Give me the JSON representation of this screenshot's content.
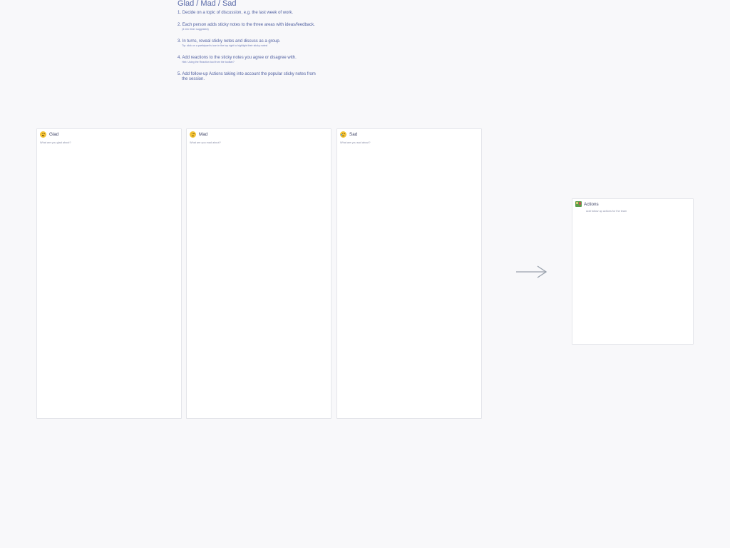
{
  "title": "Glad / Mad / Sad",
  "instructions": {
    "step1": "1. Decide on a topic of discussion, e.g. the last week of work.",
    "step2": "2. Each person adds sticky notes to the three areas with ideas/feedback.",
    "step2_sub": "(4 min timer suggested)",
    "step3": "3. In turns, reveal sticky notes and discuss as a group.",
    "step3_sub": "Tip: click on a participant's icon in the top right to highlight their sticky notes!",
    "step4": "4. Add reactions to the sticky notes you agree or disagree with.",
    "step4_sub": "Hint: Using the Reaction tool from the toolbar?",
    "step5_line1": "5. Add follow-up Actions taking into account the popular sticky notes from",
    "step5_line2": "the session."
  },
  "frames": {
    "glad": {
      "title": "Glad",
      "subtitle": "What are you glad about?"
    },
    "mad": {
      "title": "Mad",
      "subtitle": "What are you mad about?"
    },
    "sad": {
      "title": "Sad",
      "subtitle": "What are you sad about?"
    },
    "actions": {
      "title": "Actions",
      "subtitle": "Add follow up actions for the team"
    }
  },
  "icons": {
    "glad": "grinning-face-icon",
    "mad": "angry-face-icon",
    "sad": "crying-face-icon",
    "actions": "picture-icon",
    "arrow": "right-arrow-icon"
  },
  "colors": {
    "background": "#f8f8fa",
    "frame": "#ffffff",
    "frame_border": "#e4e5ea",
    "title_text": "#5a6aa8",
    "arrow": "#9aa2ad"
  }
}
